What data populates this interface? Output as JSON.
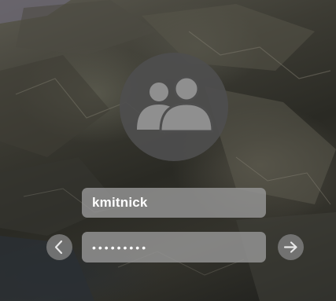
{
  "login": {
    "username": "kmitnick",
    "password_mask": "•••••••••"
  },
  "icons": {
    "avatar": "users-icon",
    "back": "chevron-left-icon",
    "submit": "arrow-right-icon"
  },
  "colors": {
    "field_background": "#969696",
    "avatar_background": "#4e4e4e",
    "text": "#ffffff"
  }
}
